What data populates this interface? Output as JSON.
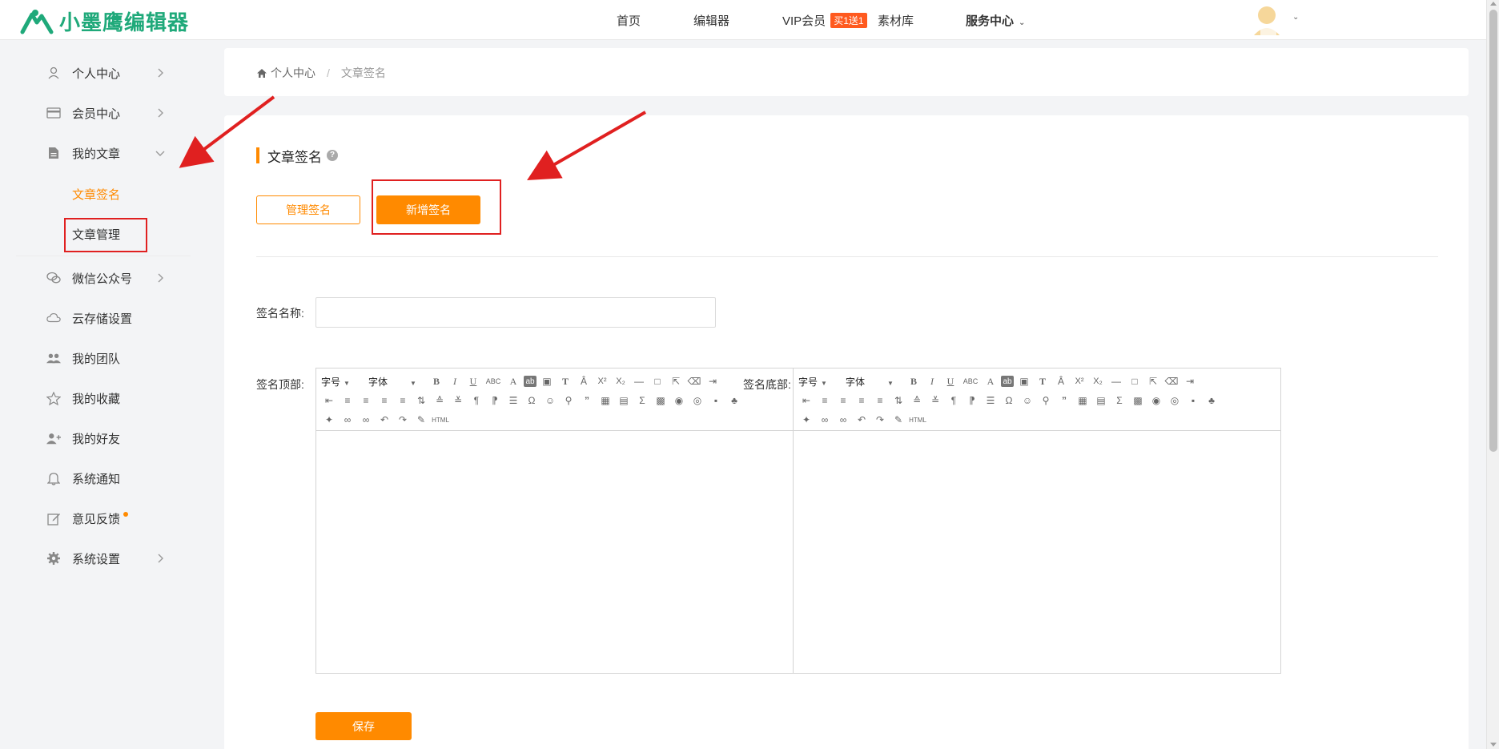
{
  "header": {
    "brand": "小墨鹰编辑器",
    "nav": {
      "home": "首页",
      "editor": "编辑器",
      "vip": "VIP会员",
      "vip_badge": "买1送1",
      "materials": "素材库",
      "service": "服务中心"
    }
  },
  "sidebar": {
    "personal": "个人中心",
    "member": "会员中心",
    "articles": "我的文章",
    "article_sign": "文章签名",
    "article_manage": "文章管理",
    "wechat": "微信公众号",
    "cloud": "云存储设置",
    "team": "我的团队",
    "favorites": "我的收藏",
    "friends": "我的好友",
    "notices": "系统通知",
    "feedback": "意见反馈",
    "settings": "系统设置"
  },
  "breadcrumb": {
    "root": "个人中心",
    "current": "文章签名"
  },
  "main": {
    "title": "文章签名",
    "btn_manage": "管理签名",
    "btn_add": "新增签名",
    "label_name": "签名名称:",
    "name_value": "",
    "label_top": "签名顶部:",
    "label_bottom": "签名底部:",
    "save": "保存"
  },
  "editor_toolbar": {
    "font_size": "字号",
    "font_family": "字体",
    "html": "HTML"
  },
  "colors": {
    "accent": "#ff8a00",
    "brand": "#1fa97a",
    "annotation": "#e02020"
  }
}
